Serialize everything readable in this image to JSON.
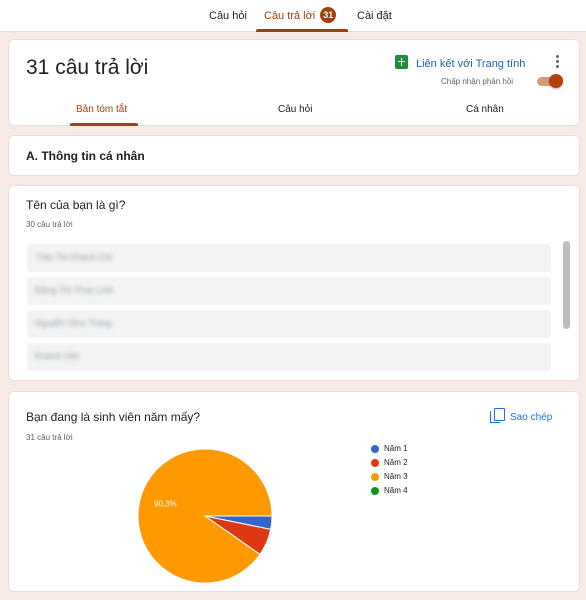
{
  "top_tabs": {
    "questions": "Câu hỏi",
    "responses": "Câu trả lời",
    "responses_badge": "31",
    "settings": "Cài đặt"
  },
  "summary": {
    "title": "31 câu trả lời",
    "sheets_link": "Liên kết với Trang tính",
    "accept_label": "Chấp nhận phản hồi",
    "accepting": true,
    "sub_tabs": [
      "Bản tóm tắt",
      "Câu hỏi",
      "Cá nhân"
    ],
    "active_sub_tab": "Bản tóm tắt"
  },
  "section": {
    "title": "A. Thông tin cá nhân"
  },
  "question1": {
    "title": "Tên của bạn là gì?",
    "count": "30 câu trả lời",
    "answers": [
      "Trần Thị Khánh Chi",
      "Đặng Thị Thuỳ Linh",
      "Nguyễn Như Trang",
      "Khánh Vân"
    ]
  },
  "question2": {
    "title": "Bạn đang là sinh viên năm mấy?",
    "count": "31 câu trả lời",
    "copy_label": "Sao chép"
  },
  "colors": {
    "accent": "#a0400f",
    "link": "#1a73e8",
    "sheets_green": "#1e8e3e"
  },
  "icons": [
    "sheets-icon",
    "more-vert-icon",
    "copy-icon"
  ],
  "chart_data": {
    "type": "pie",
    "categories": [
      "Năm 1",
      "Năm 2",
      "Năm 3",
      "Năm 4"
    ],
    "values": [
      3.2,
      6.5,
      90.3,
      0
    ],
    "colors": [
      "#3366cc",
      "#dc3912",
      "#ff9900",
      "#109618"
    ],
    "slice_labels": [
      "",
      "",
      "90,3%",
      ""
    ],
    "legend_position": "right"
  }
}
